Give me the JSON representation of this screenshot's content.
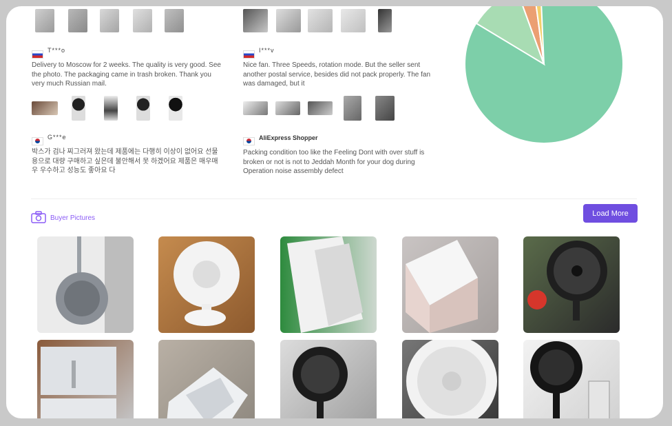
{
  "reviews": [
    {
      "country": "RU",
      "name": "T***o",
      "text": "Delivery to Moscow for 2 weeks. The quality is very good. See the photo. The packaging came in trash broken. Thank you very much Russian mail."
    },
    {
      "country": "RU",
      "name": "I***v",
      "text": "Nice fan. Three Speeds, rotation mode. But the seller sent another postal service, besides did not pack properly. The fan was damaged, but it"
    },
    {
      "country": "KR",
      "name": "G***e",
      "text": "박스가 검나 찌그러져 왔는데 제품에는 다행히 이상이 없어요 선물용으로 대량 구매하고 싶은데 불안해서 못 하겠어요 제품은 매우매우 우수하고 성능도 좋아요 다"
    },
    {
      "country": "KR",
      "name": "AliExpress Shopper",
      "text": "Packing condition too like the Feeling Dont with over stuff is broken or not is not to Jeddah Month for your dog during Operation noise assembly defect"
    }
  ],
  "buyer_pictures": {
    "label": "Buyer Pictures",
    "load_more": "Load More"
  },
  "colors": {
    "accent": "#6f4ee0",
    "pie_main": "#7dcfa9",
    "pie_light": "#a8dcb3",
    "pie_orange": "#eb9f72",
    "pie_yellow": "#f3cf6b"
  }
}
